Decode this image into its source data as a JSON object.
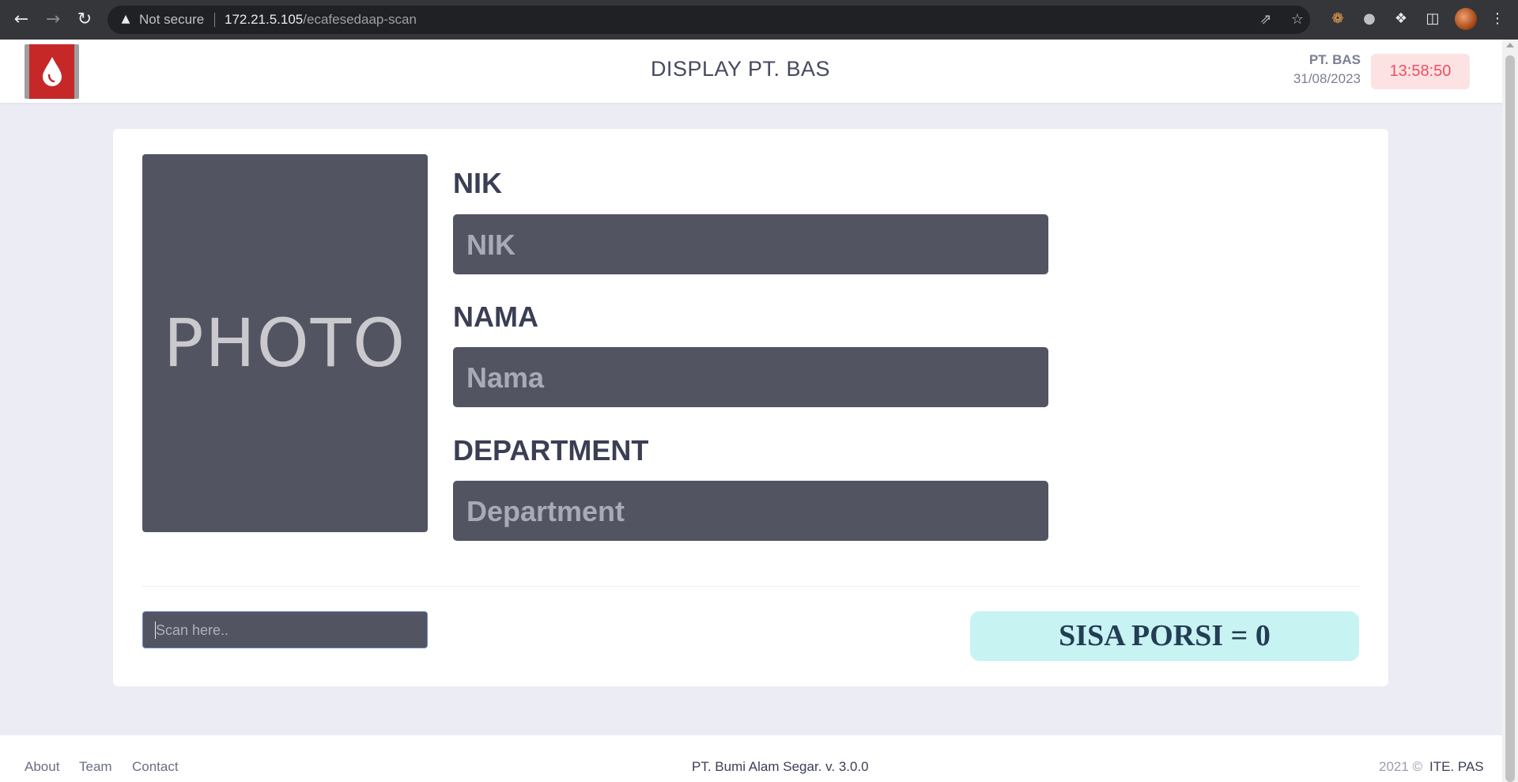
{
  "browser": {
    "security_label": "Not secure",
    "url_host": "172.21.5.105",
    "url_path": "/ecafesedaap-scan",
    "icons": [
      "back-icon",
      "forward-icon",
      "reload-icon",
      "warning-icon",
      "share-icon",
      "star-icon",
      "extension-icon",
      "globe-icon",
      "puzzle-icon",
      "sidepanel-icon",
      "profile-avatar",
      "menu-icon"
    ]
  },
  "header": {
    "title": "DISPLAY PT. BAS",
    "company": "PT. BAS",
    "date": "31/08/2023",
    "clock": "13:58:50"
  },
  "photo": {
    "placeholder": "PHOTO"
  },
  "fields": {
    "nik": {
      "label": "NIK",
      "value": "NIK"
    },
    "nama": {
      "label": "NAMA",
      "value": "Nama"
    },
    "department": {
      "label": "DEPARTMENT",
      "value": "Department"
    }
  },
  "scan": {
    "placeholder": "Scan here.."
  },
  "sisa_porsi": "SISA PORSI = 0",
  "footer": {
    "links": [
      "About",
      "Team",
      "Contact"
    ],
    "center_text": "PT. Bumi Alam Segar. v. 3.0.0",
    "year": "2021 ©",
    "brand": "ITE. PAS"
  },
  "colors": {
    "field_bg": "#525462",
    "clock_bg": "#fde2e4",
    "clock_text": "#f04e5e",
    "sisa_bg": "#c8f3f3",
    "page_bg": "#ebecf4"
  }
}
